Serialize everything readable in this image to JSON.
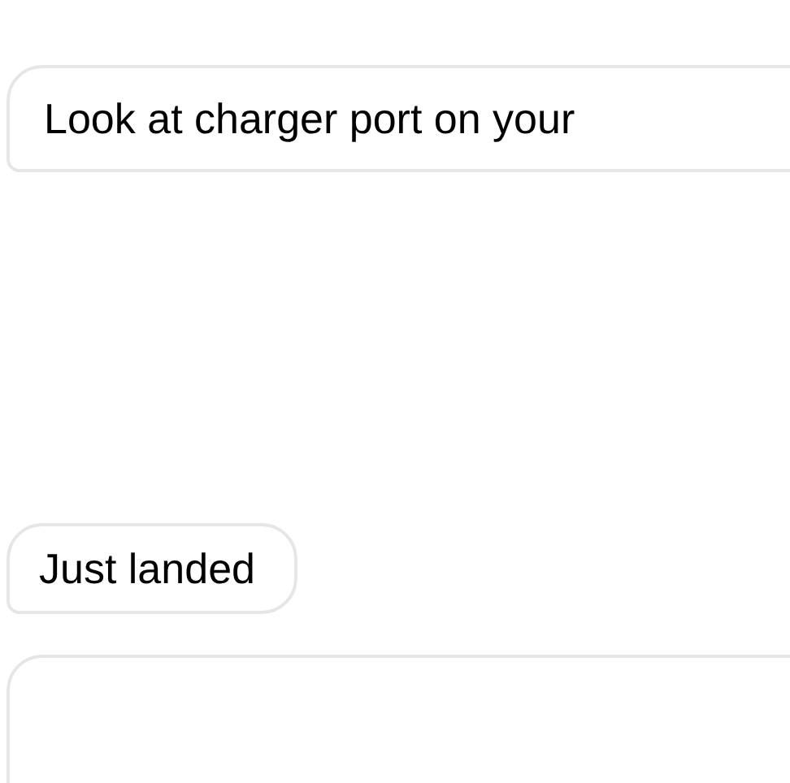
{
  "messages": [
    {
      "kind": "text",
      "text": "Look at charger port on your"
    },
    {
      "kind": "text",
      "text": "Just landed"
    },
    {
      "kind": "blank"
    }
  ]
}
